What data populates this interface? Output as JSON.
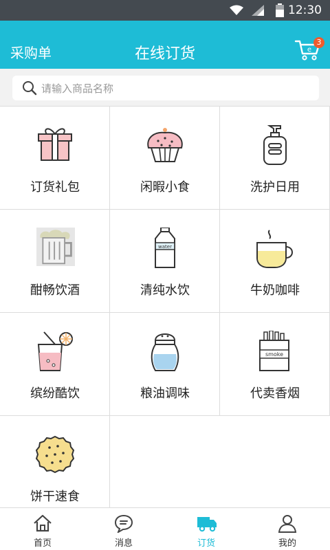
{
  "status_bar": {
    "time": "12:30",
    "icons": [
      "wifi-icon",
      "signal-icon",
      "battery-icon"
    ]
  },
  "header": {
    "left_label": "采购单",
    "title": "在线订货",
    "cart_count": "3"
  },
  "search": {
    "placeholder": "请输入商品名称"
  },
  "categories": [
    {
      "label": "订货礼包",
      "icon": "gift-icon"
    },
    {
      "label": "闲暇小食",
      "icon": "cupcake-icon"
    },
    {
      "label": "洗护日用",
      "icon": "lotion-bottle-icon"
    },
    {
      "label": "酣畅饮酒",
      "icon": "beer-mug-icon"
    },
    {
      "label": "清纯水饮",
      "icon": "water-bottle-icon"
    },
    {
      "label": "牛奶咖啡",
      "icon": "coffee-cup-icon"
    },
    {
      "label": "缤纷酷饮",
      "icon": "juice-drink-icon"
    },
    {
      "label": "粮油调味",
      "icon": "salt-shaker-icon"
    },
    {
      "label": "代卖香烟",
      "icon": "cigarette-pack-icon"
    },
    {
      "label": "饼干速食",
      "icon": "cookie-icon"
    }
  ],
  "tabs": [
    {
      "label": "首页",
      "icon": "home-icon"
    },
    {
      "label": "消息",
      "icon": "message-icon"
    },
    {
      "label": "订货",
      "icon": "truck-icon",
      "active": true
    },
    {
      "label": "我的",
      "icon": "user-icon"
    }
  ],
  "colors": {
    "brand": "#1ebcd6",
    "badge": "#f05b2d",
    "status_bar": "#444a50"
  }
}
